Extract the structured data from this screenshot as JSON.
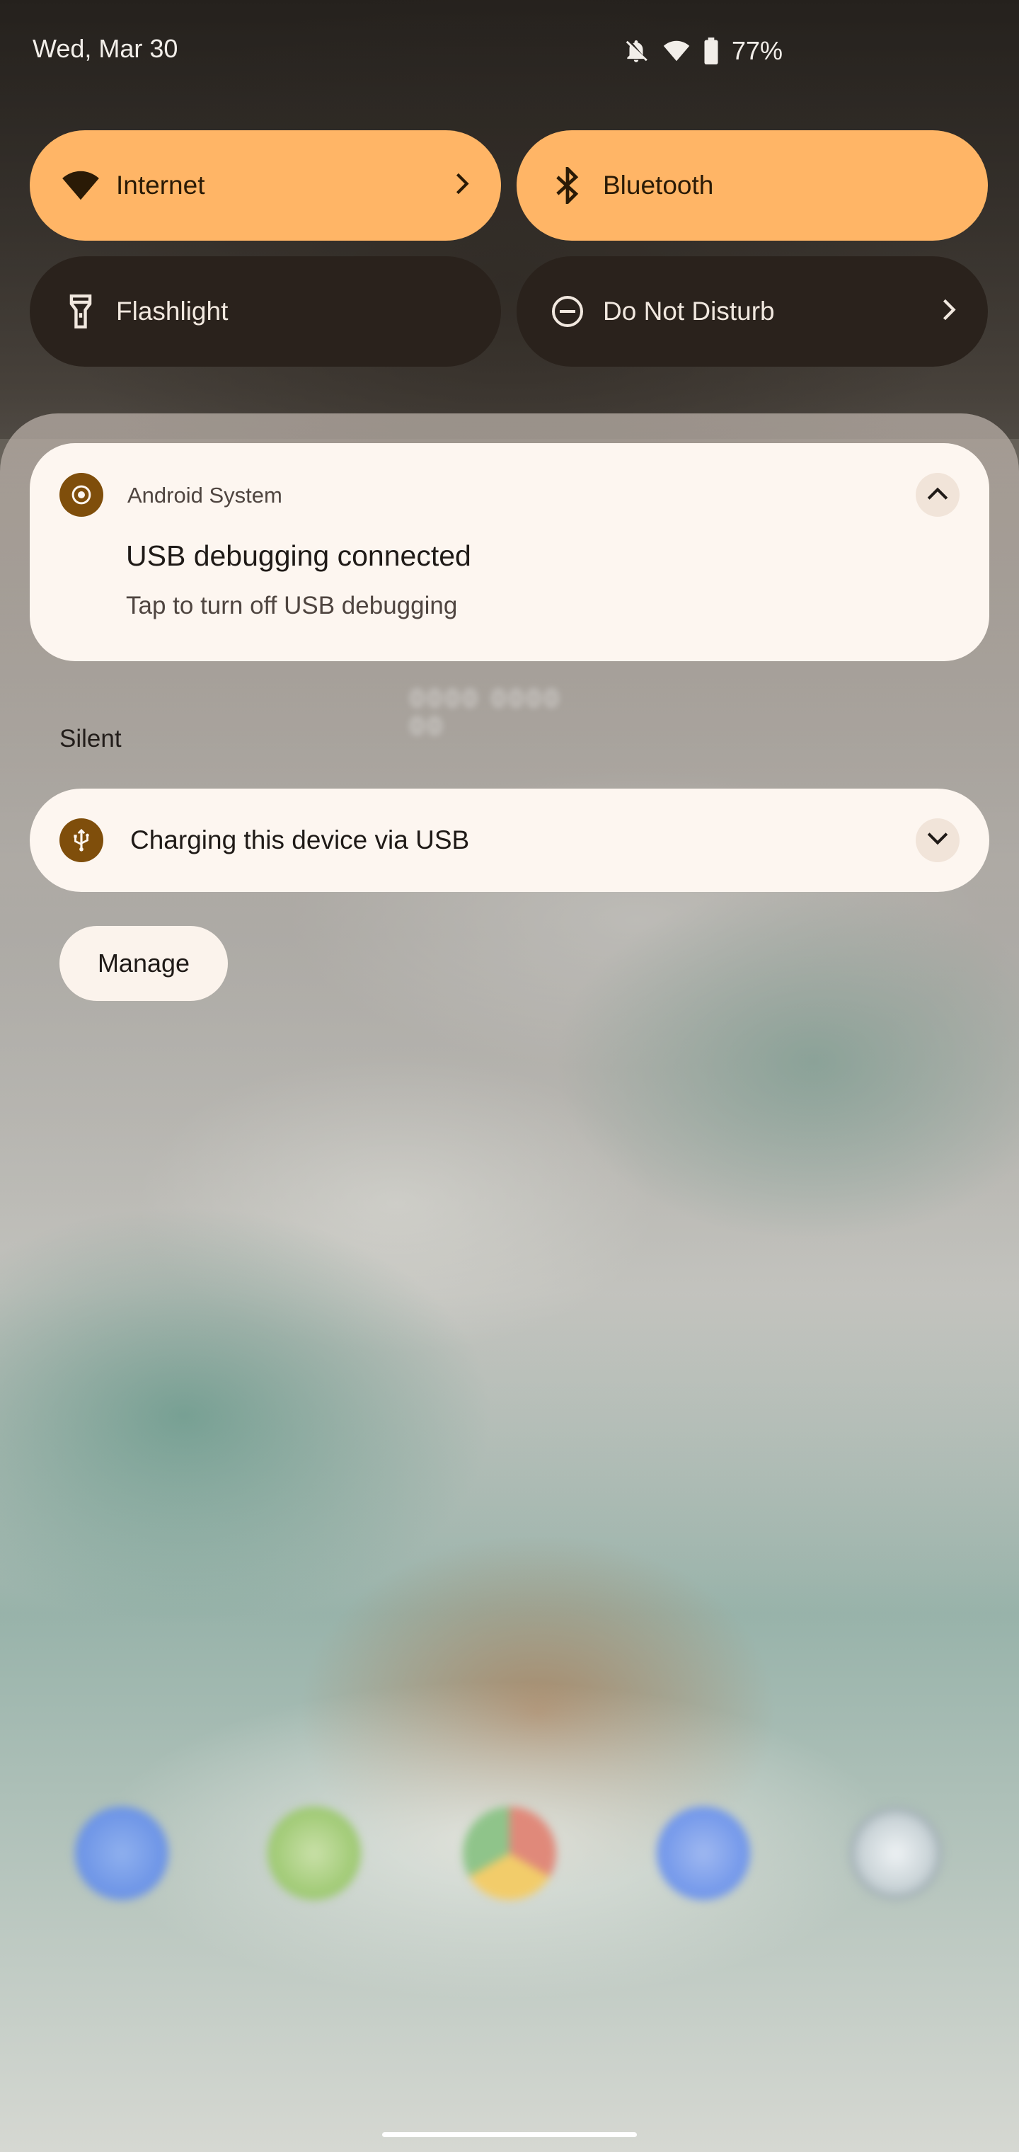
{
  "status_bar": {
    "date": "Wed, Mar 30",
    "battery": "77%",
    "icons": [
      "notifications-off-icon",
      "wifi-icon",
      "battery-icon"
    ]
  },
  "quick_settings": {
    "tiles": [
      {
        "label": "Internet",
        "icon": "wifi-icon",
        "state": "on",
        "has_chevron": true
      },
      {
        "label": "Bluetooth",
        "icon": "bluetooth-icon",
        "state": "on",
        "has_chevron": false
      },
      {
        "label": "Flashlight",
        "icon": "flashlight-icon",
        "state": "off",
        "has_chevron": false
      },
      {
        "label": "Do Not Disturb",
        "icon": "do-not-disturb-icon",
        "state": "off",
        "has_chevron": true
      }
    ]
  },
  "notifications": {
    "usb_debugging": {
      "app_name": "Android System",
      "title": "USB debugging connected",
      "text": "Tap to turn off USB debugging"
    },
    "section_header": "Silent",
    "charging": {
      "title": "Charging this device via USB"
    },
    "manage_label": "Manage"
  },
  "colors": {
    "tile_on": "#ffb566",
    "tile_off": "#2a221c",
    "card_bg": "#fdf6f0",
    "app_badge": "#7f4e0b"
  },
  "dock": {
    "apps": [
      "phone-icon",
      "messages-icon",
      "chrome-icon",
      "maps-icon",
      "camera-icon"
    ]
  }
}
